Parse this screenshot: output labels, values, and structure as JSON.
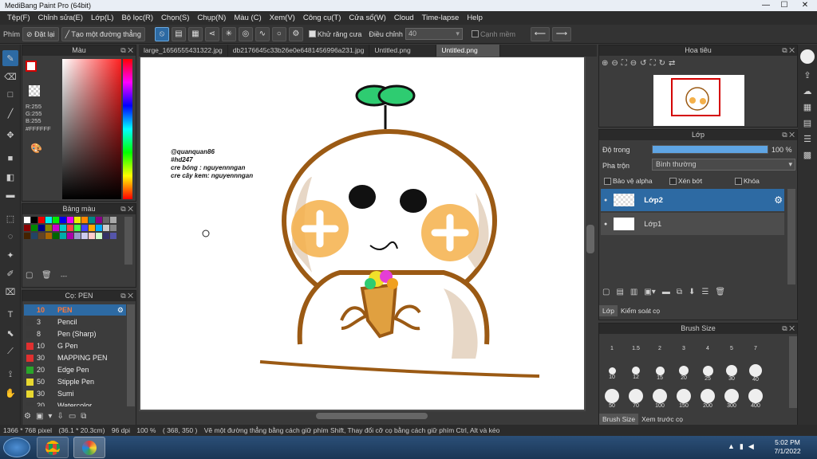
{
  "window": {
    "title": "MediBang Paint Pro (64bit)",
    "minimize": "—",
    "maximize": "☐",
    "close": "✕"
  },
  "menu": [
    "Tệp(F)",
    "Chỉnh sửa(E)",
    "Lớp(L)",
    "Bộ lọc(R)",
    "Chọn(S)",
    "Chụp(N)",
    "Màu (C)",
    "Xem(V)",
    "Công cụ(T)",
    "Cửa sổ(W)",
    "Cloud",
    "Time-lapse",
    "Help"
  ],
  "toolbar": {
    "label": "Phím",
    "reset": "Đặt lại",
    "straight_line": "Tạo một đường thẳng",
    "antialias": "Khử răng cưa",
    "adjust": "Điều chỉnh",
    "adjust_value": "40",
    "smooth_edge": "Cạnh mềm"
  },
  "color_panel": {
    "title": "Màu",
    "r": "R:255",
    "g": "G:255",
    "b": "B:255",
    "hex": "#FFFFFF"
  },
  "palette_panel": {
    "title": "Bảng màu",
    "dashes": "---"
  },
  "brush_panel": {
    "title": "Cọ: PEN",
    "items": [
      {
        "size": "10",
        "name": "PEN",
        "color": "#2d6aa3",
        "selected": true
      },
      {
        "size": "3",
        "name": "Pencil",
        "color": "#3b3b3b"
      },
      {
        "size": "8",
        "name": "Pen (Sharp)",
        "color": "#3b3b3b"
      },
      {
        "size": "10",
        "name": "G Pen",
        "color": "#e03030"
      },
      {
        "size": "30",
        "name": "MAPPING PEN",
        "color": "#e03030"
      },
      {
        "size": "20",
        "name": "Edge Pen",
        "color": "#2aa52a"
      },
      {
        "size": "50",
        "name": "Stipple Pen",
        "color": "#e8d830"
      },
      {
        "size": "30",
        "name": "Sumi",
        "color": "#e8d830"
      },
      {
        "size": "20",
        "name": "Watercolor",
        "color": "#3b3b3b"
      }
    ]
  },
  "tabs": [
    "large_1656555431322.jpg",
    "db2176645c33b26e0e6481456996a231.jpg",
    "Untitled.png",
    "Untitled.png"
  ],
  "canvas_text": {
    "line1": "@quanquan86",
    "line2": "#hd247",
    "line3": "cre bóng : nguyennngan",
    "line4": "cre cây kem: nguyennngan"
  },
  "navigator": {
    "title": "Hoa tiêu"
  },
  "layer_panel": {
    "title": "Lớp",
    "opacity_label": "Độ trong",
    "opacity_value": "100 %",
    "opacity": 1.0,
    "blend_label": "Pha trộn",
    "blend_value": "Bình thường",
    "protect_alpha": "Bảo vệ alpha",
    "clipping": "Xén bớt",
    "lock": "Khóa",
    "layers": [
      {
        "name": "Lớp2",
        "selected": true
      },
      {
        "name": "Lớp1",
        "selected": false
      }
    ],
    "tab_layer": "Lớp",
    "tab_control": "Kiểm soát cọ"
  },
  "brush_size_panel": {
    "title": "Brush Size",
    "sizes": [
      "1",
      "1.5",
      "2",
      "3",
      "4",
      "5",
      "7",
      "10",
      "12",
      "15",
      "20",
      "25",
      "30",
      "40",
      "50",
      "70",
      "100",
      "150",
      "200",
      "300",
      "400"
    ],
    "tab_size": "Brush Size",
    "tab_preview": "Xem trước cọ"
  },
  "statusbar": {
    "dims": "1366 * 768 pixel",
    "cm": "(36.1 * 20.3cm)",
    "dpi": "96 dpi",
    "zoom": "100 %",
    "pos": "( 368, 350 )",
    "hint": "Vẽ một đường thẳng bằng cách giữ phím Shift, Thay đổi cỡ cọ bằng cách giữ phím Ctrl, Alt và kéo"
  },
  "taskbar": {
    "time": "5:02 PM",
    "date": "7/1/2022"
  },
  "colors": {
    "accent": "#2d6aa3",
    "outline": "#9b5a14",
    "cheek": "#f4b04a",
    "leaf": "#2ecc71"
  }
}
